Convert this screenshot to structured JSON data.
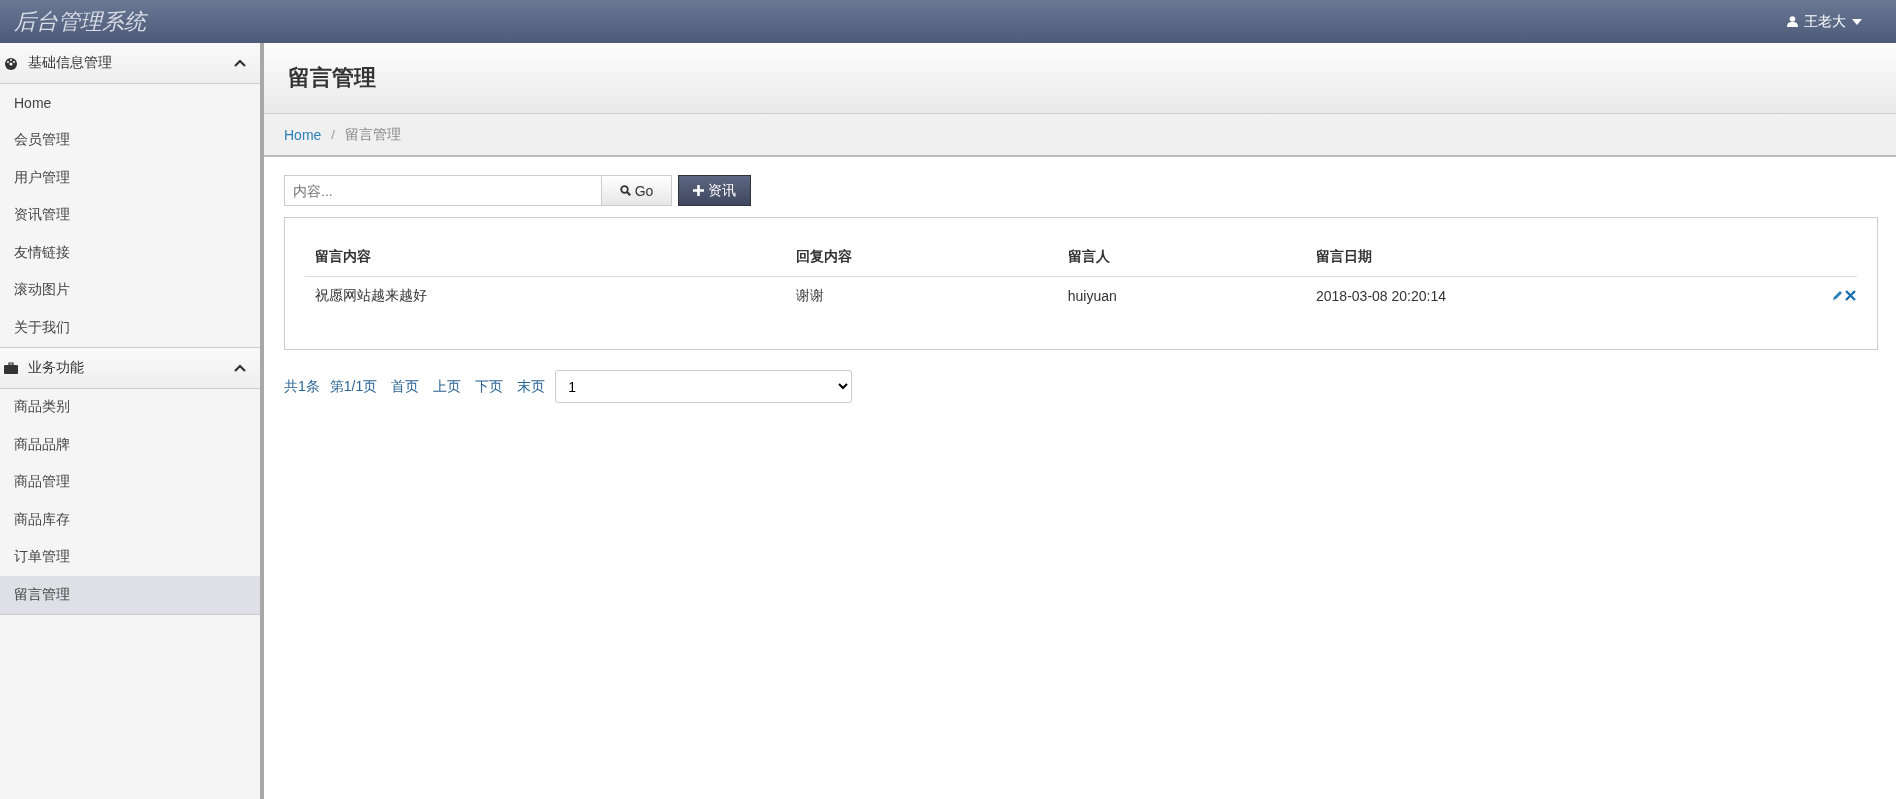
{
  "topbar": {
    "title": "后台管理系统",
    "user": "王老大"
  },
  "sidebar": {
    "groups": [
      {
        "label": "基础信息管理",
        "expanded": true,
        "items": [
          {
            "label": "Home",
            "selected": false
          },
          {
            "label": "会员管理",
            "selected": false
          },
          {
            "label": "用户管理",
            "selected": false
          },
          {
            "label": "资讯管理",
            "selected": false
          },
          {
            "label": "友情链接",
            "selected": false
          },
          {
            "label": "滚动图片",
            "selected": false
          },
          {
            "label": "关于我们",
            "selected": false
          }
        ]
      },
      {
        "label": "业务功能",
        "expanded": true,
        "items": [
          {
            "label": "商品类别",
            "selected": false
          },
          {
            "label": "商品品牌",
            "selected": false
          },
          {
            "label": "商品管理",
            "selected": false
          },
          {
            "label": "商品库存",
            "selected": false
          },
          {
            "label": "订单管理",
            "selected": false
          },
          {
            "label": "留言管理",
            "selected": true
          }
        ]
      }
    ]
  },
  "page_title": "留言管理",
  "breadcrumb": {
    "items": [
      "Home",
      "留言管理"
    ],
    "separator": "/"
  },
  "toolbar": {
    "search_placeholder": "内容...",
    "go_button": "Go",
    "add_button": "资讯"
  },
  "table": {
    "columns": [
      "留言内容",
      "回复内容",
      "留言人",
      "留言日期"
    ],
    "rows": [
      {
        "cells": [
          "祝愿网站越来越好",
          "谢谢",
          "huiyuan",
          "2018-03-08 20:20:14"
        ]
      }
    ]
  },
  "pagination": {
    "total": "共1条",
    "page": "第1/1页",
    "links": [
      "首页",
      "上页",
      "下页",
      "末页"
    ],
    "select_value": "1"
  }
}
